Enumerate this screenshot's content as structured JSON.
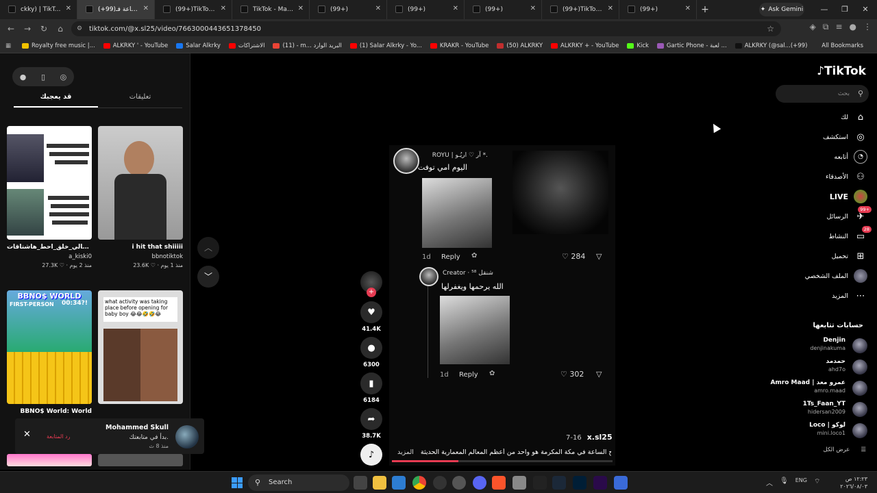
{
  "browser": {
    "tabs": [
      {
        "label": "ckky) | TikTok(+99)",
        "active": false
      },
      {
        "label": "(+99)برج الساعة فـ",
        "active": true
      },
      {
        "label": "(99+)TikTok - Make",
        "active": false
      },
      {
        "label": "TikTok - Make You",
        "active": false
      },
      {
        "label": "(99+)",
        "active": false
      },
      {
        "label": "(99+)",
        "active": false
      },
      {
        "label": "(99+)",
        "active": false
      },
      {
        "label": "(99+)TikTok - Mak",
        "active": false
      },
      {
        "label": "(99+)",
        "active": false
      }
    ],
    "new_tab": "+",
    "ask_gemini": "Ask Gemini",
    "url": "tiktok.com/@x.sl25/video/7663000443651378450",
    "bookmarks": [
      {
        "label": "Royalty free music |...",
        "color": "#f2c200"
      },
      {
        "label": "ALKRKY ' - YouTube",
        "color": "#ff0000"
      },
      {
        "label": "Salar Alkrky",
        "color": "#1877f2"
      },
      {
        "label": "الاشتراكات",
        "color": "#ff0000"
      },
      {
        "label": "(11) - m... البريد الوارد",
        "color": "#ea4335"
      },
      {
        "label": "(1) Salar Alkrky - Yo...",
        "color": "#ff0000"
      },
      {
        "label": "KRAKR - YouTube",
        "color": "#ff0000"
      },
      {
        "label": "(50) ALKRKY",
        "color": "#c12e2e"
      },
      {
        "label": "ALKRKY + - YouTube",
        "color": "#ff0000"
      },
      {
        "label": "Kick",
        "color": "#53fc18"
      },
      {
        "label": "Gartic Phone - لعبة ...",
        "color": "#9b59b6"
      },
      {
        "label": "ALKRKY (@sal...(+99)",
        "color": "#111111"
      }
    ],
    "all_bookmarks": "All Bookmarks"
  },
  "left_panel": {
    "tab_comments": "تعليقات",
    "tab_you_may_like": "قد يعجبك",
    "cards": [
      {
        "title": "احب تشوفك فكّر 😹 #مالي_خلق_احط_هاشتاقات...",
        "author": "a_kiski0",
        "meta": "27.3K ♡ · منذ 2 يوم"
      },
      {
        "title": "i hit that shiiiii",
        "author": "bbnotiktok",
        "meta": "23.6K ♡ · منذ 1 يوم"
      },
      {
        "title": "BBNO$ World: World",
        "author": "",
        "meta": ""
      },
      {
        "title": "what activity was taking place before opening for baby boy 😂😂🤣🤣😂",
        "author": "",
        "meta": ""
      }
    ],
    "card3_overlay": {
      "line1": "BBNO$ WORLD",
      "line2": "FIRST-PERSON",
      "timer": "00:34?!"
    },
    "notification": {
      "name": "Mohammed Skull",
      "text": "بدأ في متابعتك.",
      "time": "منذ 8 ث",
      "back": "رد المتابعة"
    }
  },
  "video": {
    "comment1": {
      "user": "ROYU | آر ♡ اريُـو *.",
      "text": "اليوم امي توفت",
      "time": "1d",
      "reply": "Reply",
      "likes": "284"
    },
    "comment2": {
      "user": "Creator · شنقل ⁵⁸",
      "text": "الله يرحمها ويغفرلها",
      "time": "1d",
      "reply": "Reply",
      "likes": "302"
    },
    "author": "x.sl25",
    "date": "7-16",
    "caption": "برج الساعة في مكة المكرمة هو واحد من أعظم المعالم المعمارية الحديثة",
    "more": "المزيد",
    "progress": 0.3
  },
  "actions": {
    "likes": "41.4K",
    "comments": "6300",
    "saves": "6184",
    "shares": "38.7K"
  },
  "sidebar": {
    "logo": "TikTok",
    "search_placeholder": "بحث",
    "nav": [
      {
        "label": "لك",
        "icon": "home-icon"
      },
      {
        "label": "استكشف",
        "icon": "compass-icon"
      },
      {
        "label": "أتابعه",
        "icon": "following-icon"
      },
      {
        "label": "الأصدقاء",
        "icon": "friends-icon"
      },
      {
        "label": "LIVE",
        "icon": "live-icon"
      },
      {
        "label": "الرسائل",
        "icon": "messages-icon",
        "badge": "99+"
      },
      {
        "label": "النشاط",
        "icon": "activity-icon",
        "badge": "28"
      },
      {
        "label": "تحميل",
        "icon": "upload-icon"
      },
      {
        "label": "الملف الشخصي",
        "icon": "profile-icon"
      },
      {
        "label": "المزيد",
        "icon": "more-icon"
      }
    ],
    "following_heading": "حسابات تتابعها",
    "following": [
      {
        "name": "Denjin",
        "handle": "denjinakuma"
      },
      {
        "name": "حمدمد",
        "handle": "ahd7o"
      },
      {
        "name": "Amro Maad | عمرو معد",
        "handle": "amro.maad"
      },
      {
        "name": "1Ts_Faan_YT",
        "handle": "hidersan2009"
      },
      {
        "name": "Loco | لوكو",
        "handle": "mini.loco1"
      }
    ],
    "see_all": "عرض الكل"
  },
  "taskbar": {
    "search": "Search",
    "lang": "ENG",
    "time": "١٢:٢٣ ص",
    "date": "٢٠٢٦/٠٨/٠٣"
  }
}
